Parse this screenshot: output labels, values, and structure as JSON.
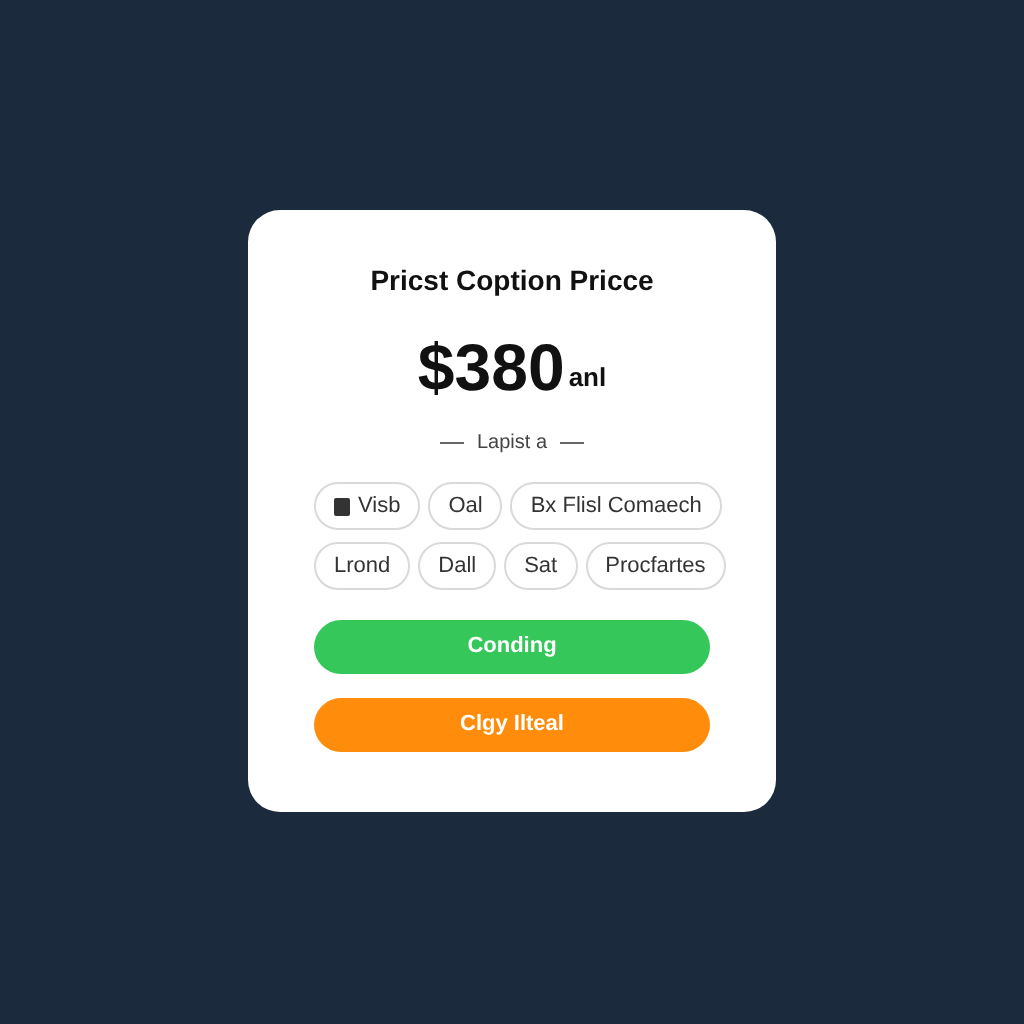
{
  "card": {
    "title": "Pricst Coption Pricce",
    "price": "$380",
    "period": "anl",
    "caption": "Lapist a"
  },
  "chips": [
    {
      "label": "Visb",
      "kind": "icon"
    },
    {
      "label": "Oal",
      "kind": "plain"
    },
    {
      "label": "Bx Flisl Comaech",
      "kind": "plain"
    },
    {
      "label": "Lrond",
      "kind": "plain"
    },
    {
      "label": "Dall",
      "kind": "plain"
    },
    {
      "label": "Sat",
      "kind": "plain"
    },
    {
      "label": "Procfartes",
      "kind": "plain"
    }
  ],
  "buttons": [
    {
      "label": "Conding",
      "kind": "primary"
    },
    {
      "label": "Clgy Ilteal",
      "kind": "accent"
    }
  ]
}
